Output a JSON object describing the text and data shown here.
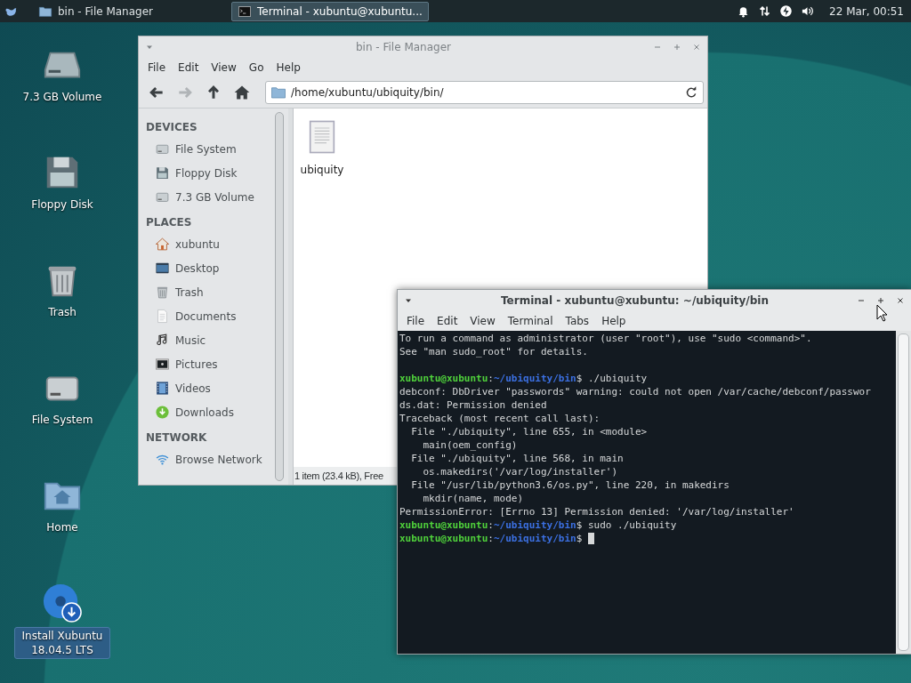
{
  "taskbar": {
    "tasks": [
      {
        "label": "bin - File Manager",
        "kind": "folder",
        "selected": false
      },
      {
        "label": "Terminal - xubuntu@xubuntu...",
        "kind": "terminal",
        "selected": true
      }
    ],
    "clock": "22 Mar, 00:51"
  },
  "desktop_icons": [
    {
      "label": "7.3 GB Volume",
      "kind": "volume",
      "selected": false
    },
    {
      "label": "Floppy Disk",
      "kind": "floppy",
      "selected": false
    },
    {
      "label": "Trash",
      "kind": "trash",
      "selected": false
    },
    {
      "label": "File System",
      "kind": "drive",
      "selected": false
    },
    {
      "label": "Home",
      "kind": "homefolder",
      "selected": false
    },
    {
      "label": "Install Xubuntu 18.04.5 LTS",
      "kind": "installer",
      "selected": true
    }
  ],
  "file_manager": {
    "title": "bin - File Manager",
    "menu": [
      "File",
      "Edit",
      "View",
      "Go",
      "Help"
    ],
    "toolbar": [
      {
        "kind": "back",
        "disabled": false
      },
      {
        "kind": "forward",
        "disabled": true
      },
      {
        "kind": "up",
        "disabled": false
      },
      {
        "kind": "home",
        "disabled": false
      }
    ],
    "location": "/home/xubuntu/ubiquity/bin/",
    "sidebar": [
      {
        "heading": "DEVICES",
        "items": [
          {
            "label": "File System",
            "kind": "drive"
          },
          {
            "label": "Floppy Disk",
            "kind": "floppy"
          },
          {
            "label": "7.3 GB Volume",
            "kind": "drive"
          }
        ]
      },
      {
        "heading": "PLACES",
        "items": [
          {
            "label": "xubuntu",
            "kind": "home"
          },
          {
            "label": "Desktop",
            "kind": "desktop"
          },
          {
            "label": "Trash",
            "kind": "trash"
          },
          {
            "label": "Documents",
            "kind": "document"
          },
          {
            "label": "Music",
            "kind": "music"
          },
          {
            "label": "Pictures",
            "kind": "pictures"
          },
          {
            "label": "Videos",
            "kind": "videos"
          },
          {
            "label": "Downloads",
            "kind": "downloads"
          }
        ]
      },
      {
        "heading": "NETWORK",
        "items": [
          {
            "label": "Browse Network",
            "kind": "network"
          }
        ]
      }
    ],
    "files": [
      {
        "name": "ubiquity"
      }
    ],
    "status": "1 item (23.4 kB), Free"
  },
  "terminal": {
    "title": "Terminal - xubuntu@xubuntu: ~/ubiquity/bin",
    "menu": [
      "File",
      "Edit",
      "View",
      "Terminal",
      "Tabs",
      "Help"
    ],
    "lines": [
      {
        "kind": "output",
        "text": "To run a command as administrator (user \"root\"), use \"sudo <command>\"."
      },
      {
        "kind": "output",
        "text": "See \"man sudo_root\" for details."
      },
      {
        "kind": "blank"
      },
      {
        "kind": "prompt",
        "user": "xubuntu@xubuntu",
        "sep": ":",
        "path": "~/ubiquity/bin",
        "command": "$ ./ubiquity",
        "cursor": false
      },
      {
        "kind": "output",
        "text": "debconf: DbDriver \"passwords\" warning: could not open /var/cache/debconf/passwor"
      },
      {
        "kind": "output",
        "text": "ds.dat: Permission denied"
      },
      {
        "kind": "output",
        "text": "Traceback (most recent call last):"
      },
      {
        "kind": "output",
        "text": "  File \"./ubiquity\", line 655, in <module>"
      },
      {
        "kind": "output",
        "text": "    main(oem_config)"
      },
      {
        "kind": "output",
        "text": "  File \"./ubiquity\", line 568, in main"
      },
      {
        "kind": "output",
        "text": "    os.makedirs('/var/log/installer')"
      },
      {
        "kind": "output",
        "text": "  File \"/usr/lib/python3.6/os.py\", line 220, in makedirs"
      },
      {
        "kind": "output",
        "text": "    mkdir(name, mode)"
      },
      {
        "kind": "output",
        "text": "PermissionError: [Errno 13] Permission denied: '/var/log/installer'"
      },
      {
        "kind": "prompt",
        "user": "xubuntu@xubuntu",
        "sep": ":",
        "path": "~/ubiquity/bin",
        "command": "$ sudo ./ubiquity",
        "cursor": false
      },
      {
        "kind": "prompt",
        "user": "xubuntu@xubuntu",
        "sep": ":",
        "path": "~/ubiquity/bin",
        "command": "$",
        "cursor": true
      }
    ]
  }
}
